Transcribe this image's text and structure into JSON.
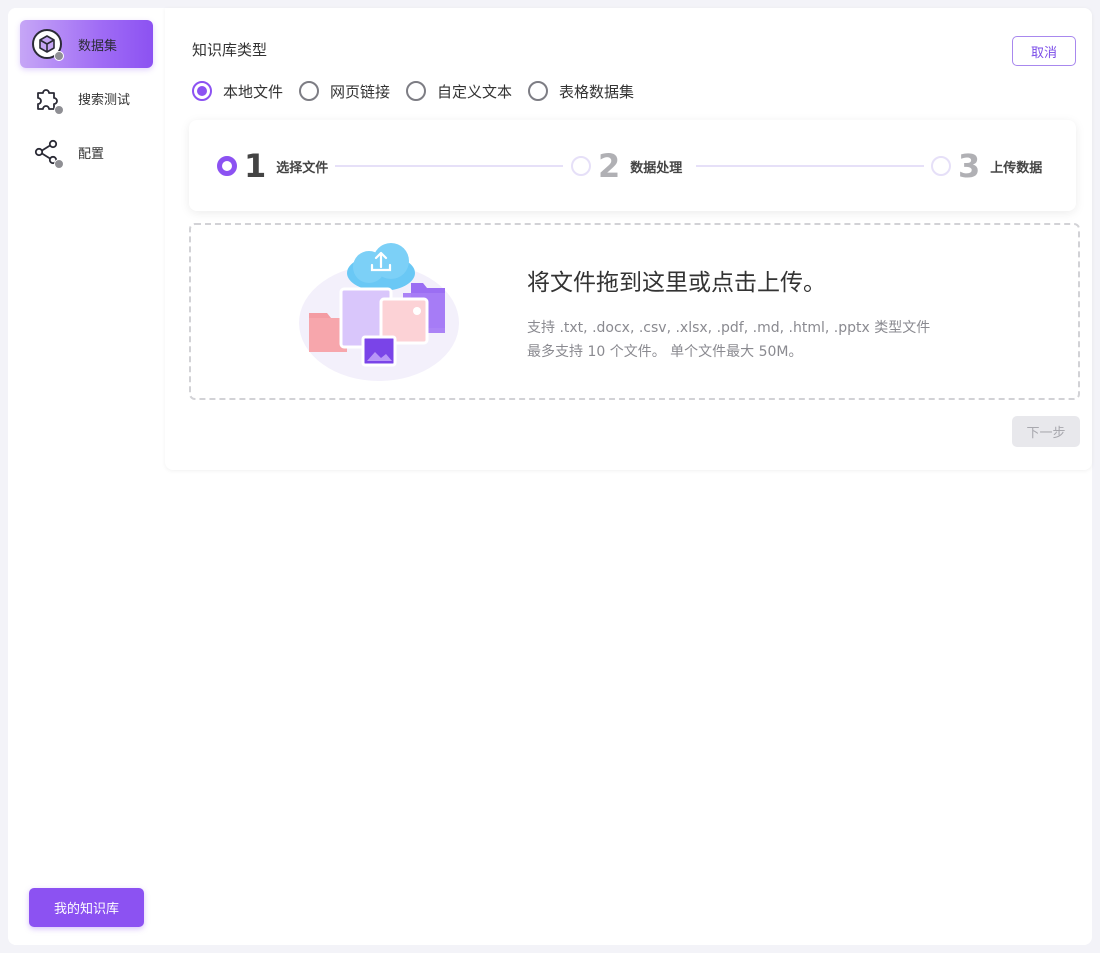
{
  "sidebar": {
    "items": [
      {
        "label": "数据集",
        "icon": "cube-icon",
        "active": true
      },
      {
        "label": "搜索测试",
        "icon": "puzzle-icon",
        "active": false
      },
      {
        "label": "配置",
        "icon": "share-icon",
        "active": false
      }
    ],
    "my_kb_label": "我的知识库"
  },
  "main": {
    "section_title": "知识库类型",
    "cancel_label": "取消",
    "kb_types": [
      {
        "label": "本地文件",
        "checked": true
      },
      {
        "label": "网页链接",
        "checked": false
      },
      {
        "label": "自定义文本",
        "checked": false
      },
      {
        "label": "表格数据集",
        "checked": false
      }
    ],
    "steps": [
      {
        "num": "1",
        "label": "选择文件",
        "active": true
      },
      {
        "num": "2",
        "label": "数据处理",
        "active": false
      },
      {
        "num": "3",
        "label": "上传数据",
        "active": false
      }
    ],
    "upload": {
      "title": "将文件拖到这里或点击上传。",
      "hint_types": "支持 .txt, .docx, .csv, .xlsx, .pdf, .md, .html, .pptx 类型文件",
      "hint_limits": "最多支持 10 个文件。 单个文件最大 50M。"
    },
    "next_label": "下一步"
  },
  "colors": {
    "accent": "#8c52f2",
    "accent_light": "#c6a6f6",
    "step_inactive": "#e6e0f8",
    "disabled_bg": "#e8e8ec"
  }
}
